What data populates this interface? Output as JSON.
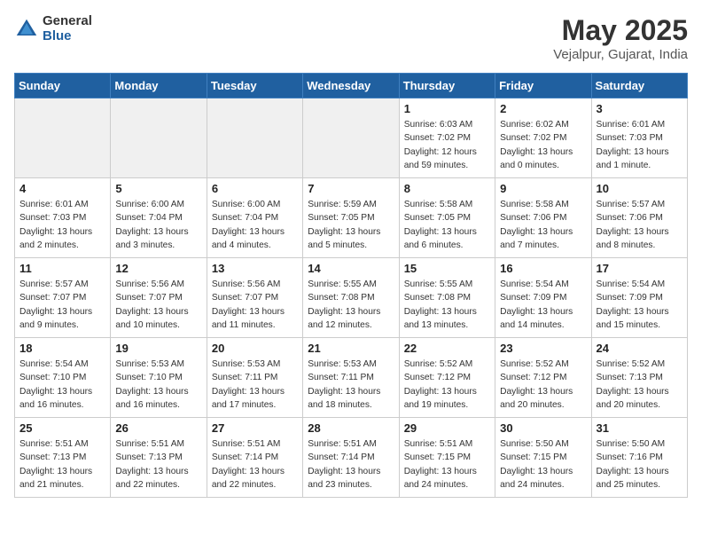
{
  "header": {
    "logo_general": "General",
    "logo_blue": "Blue",
    "month_title": "May 2025",
    "location": "Vejalpur, Gujarat, India"
  },
  "days_of_week": [
    "Sunday",
    "Monday",
    "Tuesday",
    "Wednesday",
    "Thursday",
    "Friday",
    "Saturday"
  ],
  "weeks": [
    [
      {
        "day": "",
        "empty": true
      },
      {
        "day": "",
        "empty": true
      },
      {
        "day": "",
        "empty": true
      },
      {
        "day": "",
        "empty": true
      },
      {
        "day": "1",
        "sunrise": "6:03 AM",
        "sunset": "7:02 PM",
        "daylight": "12 hours and 59 minutes."
      },
      {
        "day": "2",
        "sunrise": "6:02 AM",
        "sunset": "7:02 PM",
        "daylight": "13 hours and 0 minutes."
      },
      {
        "day": "3",
        "sunrise": "6:01 AM",
        "sunset": "7:03 PM",
        "daylight": "13 hours and 1 minute."
      }
    ],
    [
      {
        "day": "4",
        "sunrise": "6:01 AM",
        "sunset": "7:03 PM",
        "daylight": "13 hours and 2 minutes."
      },
      {
        "day": "5",
        "sunrise": "6:00 AM",
        "sunset": "7:04 PM",
        "daylight": "13 hours and 3 minutes."
      },
      {
        "day": "6",
        "sunrise": "6:00 AM",
        "sunset": "7:04 PM",
        "daylight": "13 hours and 4 minutes."
      },
      {
        "day": "7",
        "sunrise": "5:59 AM",
        "sunset": "7:05 PM",
        "daylight": "13 hours and 5 minutes."
      },
      {
        "day": "8",
        "sunrise": "5:58 AM",
        "sunset": "7:05 PM",
        "daylight": "13 hours and 6 minutes."
      },
      {
        "day": "9",
        "sunrise": "5:58 AM",
        "sunset": "7:06 PM",
        "daylight": "13 hours and 7 minutes."
      },
      {
        "day": "10",
        "sunrise": "5:57 AM",
        "sunset": "7:06 PM",
        "daylight": "13 hours and 8 minutes."
      }
    ],
    [
      {
        "day": "11",
        "sunrise": "5:57 AM",
        "sunset": "7:07 PM",
        "daylight": "13 hours and 9 minutes."
      },
      {
        "day": "12",
        "sunrise": "5:56 AM",
        "sunset": "7:07 PM",
        "daylight": "13 hours and 10 minutes."
      },
      {
        "day": "13",
        "sunrise": "5:56 AM",
        "sunset": "7:07 PM",
        "daylight": "13 hours and 11 minutes."
      },
      {
        "day": "14",
        "sunrise": "5:55 AM",
        "sunset": "7:08 PM",
        "daylight": "13 hours and 12 minutes."
      },
      {
        "day": "15",
        "sunrise": "5:55 AM",
        "sunset": "7:08 PM",
        "daylight": "13 hours and 13 minutes."
      },
      {
        "day": "16",
        "sunrise": "5:54 AM",
        "sunset": "7:09 PM",
        "daylight": "13 hours and 14 minutes."
      },
      {
        "day": "17",
        "sunrise": "5:54 AM",
        "sunset": "7:09 PM",
        "daylight": "13 hours and 15 minutes."
      }
    ],
    [
      {
        "day": "18",
        "sunrise": "5:54 AM",
        "sunset": "7:10 PM",
        "daylight": "13 hours and 16 minutes."
      },
      {
        "day": "19",
        "sunrise": "5:53 AM",
        "sunset": "7:10 PM",
        "daylight": "13 hours and 16 minutes."
      },
      {
        "day": "20",
        "sunrise": "5:53 AM",
        "sunset": "7:11 PM",
        "daylight": "13 hours and 17 minutes."
      },
      {
        "day": "21",
        "sunrise": "5:53 AM",
        "sunset": "7:11 PM",
        "daylight": "13 hours and 18 minutes."
      },
      {
        "day": "22",
        "sunrise": "5:52 AM",
        "sunset": "7:12 PM",
        "daylight": "13 hours and 19 minutes."
      },
      {
        "day": "23",
        "sunrise": "5:52 AM",
        "sunset": "7:12 PM",
        "daylight": "13 hours and 20 minutes."
      },
      {
        "day": "24",
        "sunrise": "5:52 AM",
        "sunset": "7:13 PM",
        "daylight": "13 hours and 20 minutes."
      }
    ],
    [
      {
        "day": "25",
        "sunrise": "5:51 AM",
        "sunset": "7:13 PM",
        "daylight": "13 hours and 21 minutes."
      },
      {
        "day": "26",
        "sunrise": "5:51 AM",
        "sunset": "7:13 PM",
        "daylight": "13 hours and 22 minutes."
      },
      {
        "day": "27",
        "sunrise": "5:51 AM",
        "sunset": "7:14 PM",
        "daylight": "13 hours and 22 minutes."
      },
      {
        "day": "28",
        "sunrise": "5:51 AM",
        "sunset": "7:14 PM",
        "daylight": "13 hours and 23 minutes."
      },
      {
        "day": "29",
        "sunrise": "5:51 AM",
        "sunset": "7:15 PM",
        "daylight": "13 hours and 24 minutes."
      },
      {
        "day": "30",
        "sunrise": "5:50 AM",
        "sunset": "7:15 PM",
        "daylight": "13 hours and 24 minutes."
      },
      {
        "day": "31",
        "sunrise": "5:50 AM",
        "sunset": "7:16 PM",
        "daylight": "13 hours and 25 minutes."
      }
    ]
  ]
}
